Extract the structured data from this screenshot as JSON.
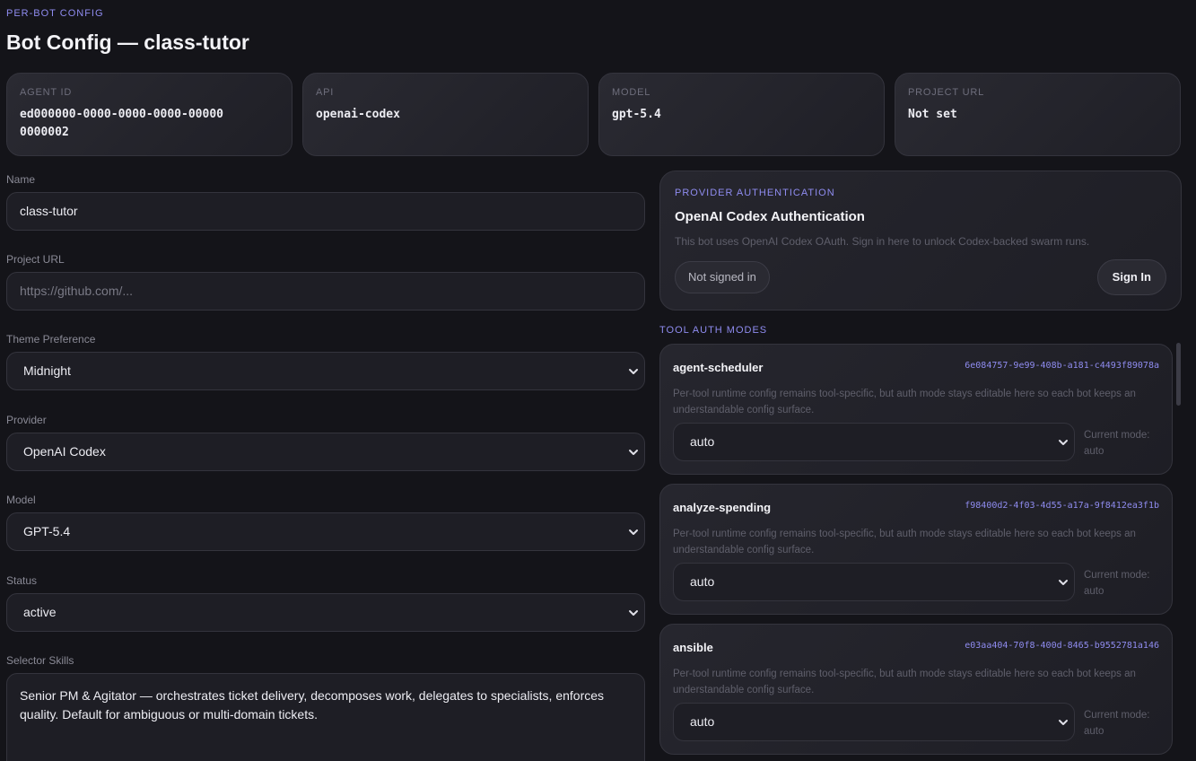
{
  "header": {
    "eyebrow": "PER-BOT CONFIG",
    "title": "Bot Config — class-tutor"
  },
  "stats": [
    {
      "label": "AGENT ID",
      "value": "ed000000-0000-0000-0000-000000000002"
    },
    {
      "label": "API",
      "value": "openai-codex"
    },
    {
      "label": "MODEL",
      "value": "gpt-5.4"
    },
    {
      "label": "PROJECT URL",
      "value": "Not set"
    }
  ],
  "form": {
    "name": {
      "label": "Name",
      "value": "class-tutor"
    },
    "project_url": {
      "label": "Project URL",
      "placeholder": "https://github.com/..."
    },
    "theme": {
      "label": "Theme Preference",
      "value": "Midnight"
    },
    "provider": {
      "label": "Provider",
      "value": "OpenAI Codex"
    },
    "model": {
      "label": "Model",
      "value": "GPT-5.4"
    },
    "status": {
      "label": "Status",
      "value": "active"
    },
    "selector_skills": {
      "label": "Selector Skills",
      "value": "Senior PM & Agitator — orchestrates ticket delivery, decomposes work, delegates to specialists, enforces quality. Default for ambiguous or multi-domain tickets."
    }
  },
  "auth": {
    "eyebrow": "PROVIDER AUTHENTICATION",
    "title": "OpenAI Codex Authentication",
    "description": "This bot uses OpenAI Codex OAuth. Sign in here to unlock Codex-backed swarm runs.",
    "status_pill": "Not signed in",
    "signin_label": "Sign In"
  },
  "tools": {
    "eyebrow": "TOOL AUTH MODES",
    "items": [
      {
        "name": "agent-scheduler",
        "id": "6e084757-9e99-408b-a181-c4493f89078a",
        "description": "Per-tool runtime config remains tool-specific, but auth mode stays editable here so each bot keeps an understandable config surface.",
        "mode": "auto",
        "current_mode_label": "Current mode:",
        "current_mode": "auto"
      },
      {
        "name": "analyze-spending",
        "id": "f98400d2-4f03-4d55-a17a-9f8412ea3f1b",
        "description": "Per-tool runtime config remains tool-specific, but auth mode stays editable here so each bot keeps an understandable config surface.",
        "mode": "auto",
        "current_mode_label": "Current mode:",
        "current_mode": "auto"
      },
      {
        "name": "ansible",
        "id": "e03aa404-70f8-400d-8465-b9552781a146",
        "description": "Per-tool runtime config remains tool-specific, but auth mode stays editable here so each bot keeps an understandable config surface.",
        "mode": "auto",
        "current_mode_label": "Current mode:",
        "current_mode": "auto"
      }
    ]
  },
  "colors": {
    "accent": "#8f8cf0",
    "background": "#141419",
    "card": "#26262e"
  }
}
